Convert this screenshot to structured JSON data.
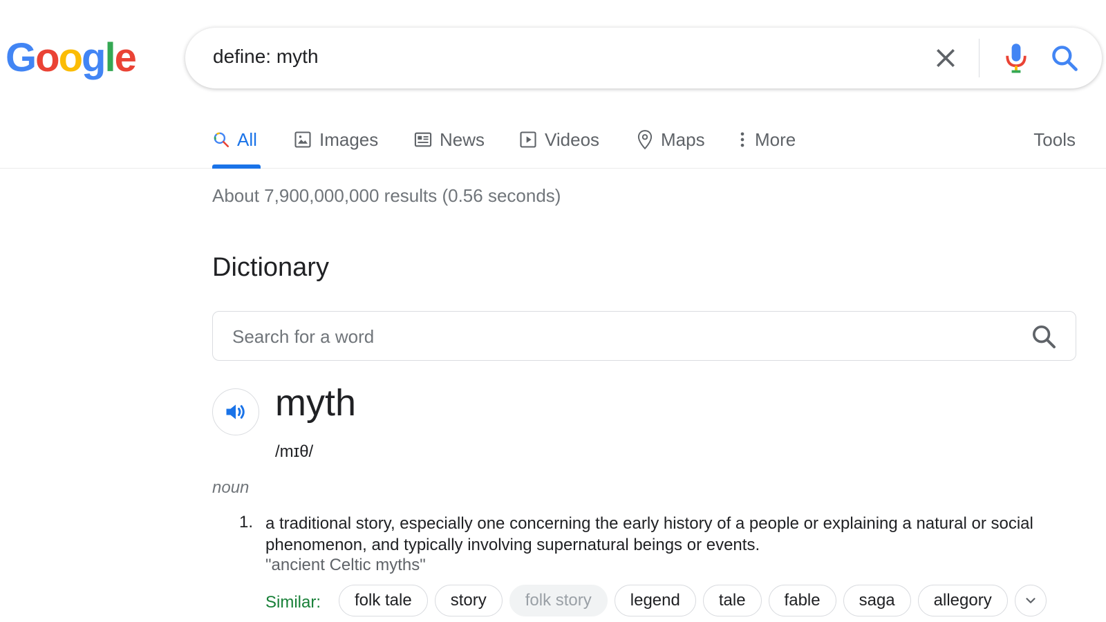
{
  "logo": {
    "letters": [
      "G",
      "o",
      "o",
      "g",
      "l",
      "e"
    ],
    "colors": [
      "#4285F4",
      "#EA4335",
      "#FBBC05",
      "#4285F4",
      "#34A853",
      "#EA4335"
    ]
  },
  "search": {
    "query": "define: myth"
  },
  "tabs": [
    {
      "label": "All",
      "icon": "search-icon",
      "active": true
    },
    {
      "label": "Images",
      "icon": "image-icon",
      "active": false
    },
    {
      "label": "News",
      "icon": "newspaper-icon",
      "active": false
    },
    {
      "label": "Videos",
      "icon": "play-icon",
      "active": false
    },
    {
      "label": "Maps",
      "icon": "map-pin-icon",
      "active": false
    },
    {
      "label": "More",
      "icon": "more-vert-icon",
      "active": false
    }
  ],
  "tools_label": "Tools",
  "stats": "About 7,900,000,000 results (0.56 seconds)",
  "dictionary": {
    "title": "Dictionary",
    "search_placeholder": "Search for a word",
    "word": "myth",
    "phonetic": "/mɪθ/",
    "part_of_speech": "noun",
    "definition_number": "1.",
    "definition": "a traditional story, especially one concerning the early history of a people or explaining a natural or social phenomenon, and typically involving supernatural beings or events.",
    "example": "\"ancient Celtic myths\"",
    "similar_label": "Similar:",
    "similar": [
      "folk tale",
      "story",
      "folk story",
      "legend",
      "tale",
      "fable",
      "saga",
      "allegory"
    ]
  },
  "colors": {
    "accent": "#1a73e8",
    "similar_green": "#188038"
  }
}
